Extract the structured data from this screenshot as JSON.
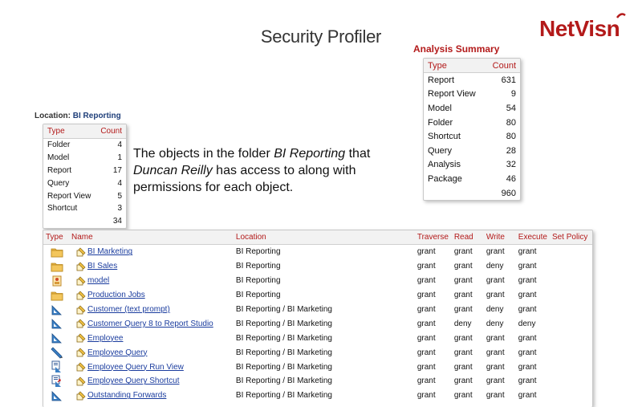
{
  "page": {
    "title": "Security Profiler"
  },
  "logo": {
    "text": "NetVisn"
  },
  "analysis_summary": {
    "title": "Analysis Summary",
    "columns": [
      "Type",
      "Count"
    ],
    "rows": [
      {
        "type": "Report",
        "count": "631"
      },
      {
        "type": "Report View",
        "count": "9"
      },
      {
        "type": "Model",
        "count": "54"
      },
      {
        "type": "Folder",
        "count": "80"
      },
      {
        "type": "Shortcut",
        "count": "80"
      },
      {
        "type": "Query",
        "count": "28"
      },
      {
        "type": "Analysis",
        "count": "32"
      },
      {
        "type": "Package",
        "count": "46"
      }
    ],
    "total": "960"
  },
  "location": {
    "label": "Location:",
    "value": "BI Reporting",
    "columns": [
      "Type",
      "Count"
    ],
    "rows": [
      {
        "type": "Folder",
        "count": "4"
      },
      {
        "type": "Model",
        "count": "1"
      },
      {
        "type": "Report",
        "count": "17"
      },
      {
        "type": "Query",
        "count": "4"
      },
      {
        "type": "Report View",
        "count": "5"
      },
      {
        "type": "Shortcut",
        "count": "3"
      }
    ],
    "total": "34"
  },
  "description": {
    "part1": "The objects in the folder ",
    "folder": "BI Reporting",
    "part2": " that ",
    "user": "Duncan Reilly",
    "part3": " has access to along with permissions for each object."
  },
  "objects_table": {
    "columns": {
      "type": "Type",
      "name": "Name",
      "location": "Location",
      "traverse": "Traverse",
      "read": "Read",
      "write": "Write",
      "execute": "Execute",
      "set_policy": "Set Policy"
    },
    "rows": [
      {
        "icon": "folder-icon",
        "name": "BI Marketing",
        "location": "BI Reporting",
        "traverse": "grant",
        "read": "grant",
        "write": "grant",
        "execute": "grant",
        "set_policy": ""
      },
      {
        "icon": "folder-icon",
        "name": "BI Sales",
        "location": "BI Reporting",
        "traverse": "grant",
        "read": "grant",
        "write": "deny",
        "execute": "grant",
        "set_policy": ""
      },
      {
        "icon": "model-icon",
        "name": "model",
        "location": "BI Reporting",
        "traverse": "grant",
        "read": "grant",
        "write": "grant",
        "execute": "grant",
        "set_policy": ""
      },
      {
        "icon": "folder-icon",
        "name": "Production Jobs",
        "location": "BI Reporting",
        "traverse": "grant",
        "read": "grant",
        "write": "grant",
        "execute": "grant",
        "set_policy": ""
      },
      {
        "icon": "query-icon",
        "name": "Customer (text prompt)",
        "location": "BI Reporting / BI Marketing",
        "traverse": "grant",
        "read": "grant",
        "write": "deny",
        "execute": "grant",
        "set_policy": ""
      },
      {
        "icon": "query-icon",
        "name": "Customer Query 8 to Report Studio",
        "location": "BI Reporting / BI Marketing",
        "traverse": "grant",
        "read": "deny",
        "write": "deny",
        "execute": "deny",
        "set_policy": ""
      },
      {
        "icon": "query-icon",
        "name": "Employee",
        "location": "BI Reporting / BI Marketing",
        "traverse": "grant",
        "read": "grant",
        "write": "grant",
        "execute": "grant",
        "set_policy": ""
      },
      {
        "icon": "pencil-icon",
        "name": "Employee Query",
        "location": "BI Reporting / BI Marketing",
        "traverse": "grant",
        "read": "grant",
        "write": "grant",
        "execute": "grant",
        "set_policy": ""
      },
      {
        "icon": "report-view-icon",
        "name": "Employee Query Run View",
        "location": "BI Reporting / BI Marketing",
        "traverse": "grant",
        "read": "grant",
        "write": "grant",
        "execute": "grant",
        "set_policy": ""
      },
      {
        "icon": "report-shortcut-icon",
        "name": "Employee Query Shortcut",
        "location": "BI Reporting / BI Marketing",
        "traverse": "grant",
        "read": "grant",
        "write": "grant",
        "execute": "grant",
        "set_policy": ""
      },
      {
        "icon": "query-icon",
        "name": "Outstanding Forwards",
        "location": "BI Reporting / BI Marketing",
        "traverse": "grant",
        "read": "grant",
        "write": "grant",
        "execute": "grant",
        "set_policy": ""
      }
    ]
  },
  "colors": {
    "accent": "#b31a1a",
    "link": "#1a3c9e",
    "folder": "#e8b545"
  }
}
